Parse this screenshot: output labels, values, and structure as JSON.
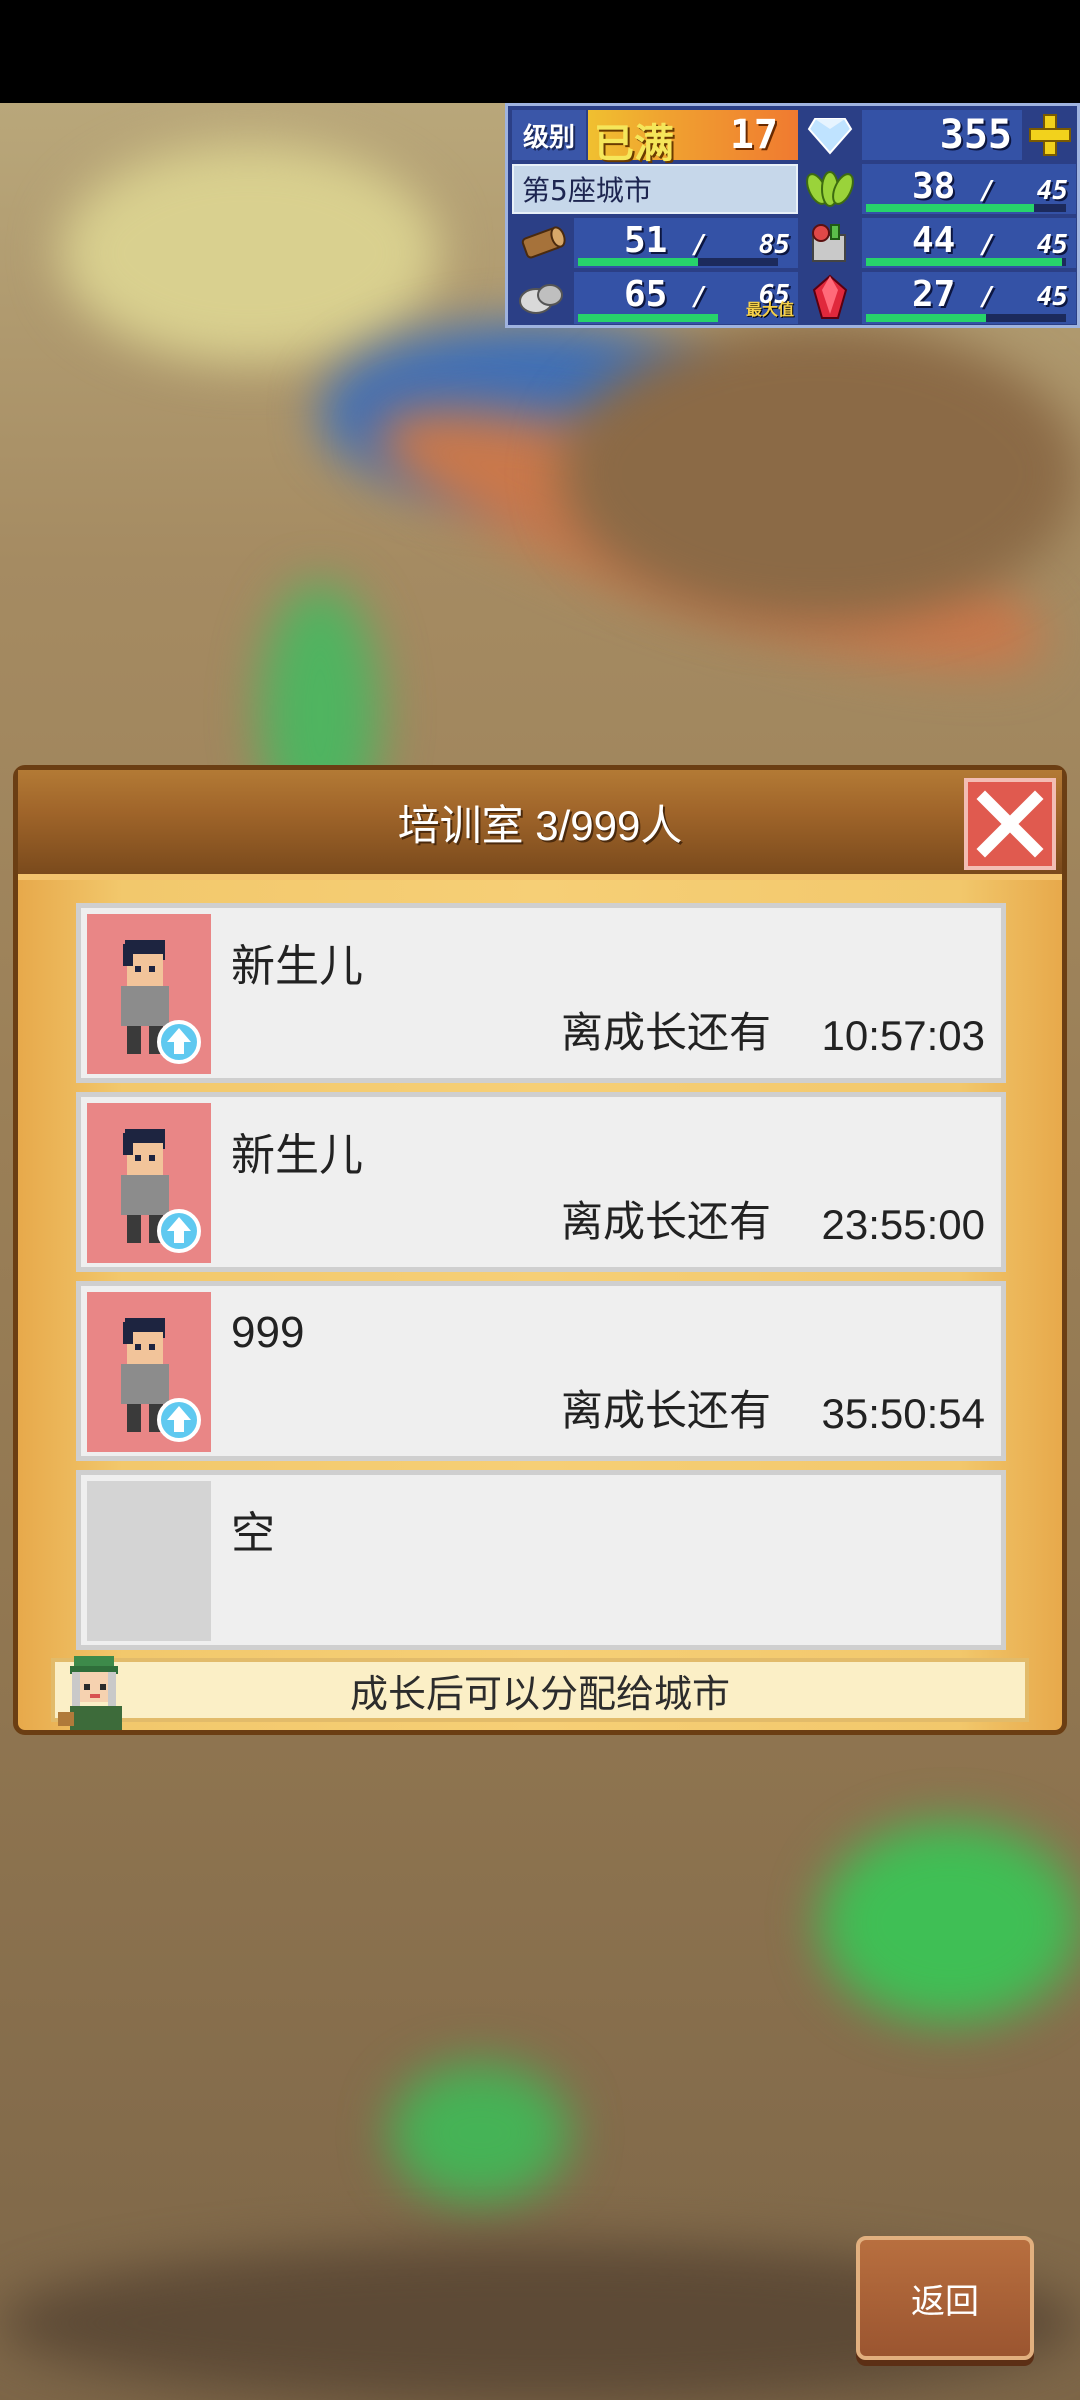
{
  "hud": {
    "level_label": "级别",
    "level_badge": "已满",
    "level_value": "17",
    "diamonds": "355",
    "city_name": "第5座城市",
    "resources": [
      {
        "icon": "wood-log-icon",
        "current": "51",
        "max": "85",
        "fill_fraction": 0.6
      },
      {
        "icon": "stone-ore-icon",
        "current": "65",
        "max": "65",
        "max_note": "最大值",
        "fill_fraction": 1.0
      },
      {
        "icon": "crop-grain-icon",
        "current": "38",
        "max": "45",
        "fill_fraction": 0.84
      },
      {
        "icon": "food-supplies-icon",
        "current": "44",
        "max": "45",
        "fill_fraction": 0.98
      },
      {
        "icon": "red-crystal-icon",
        "current": "27",
        "max": "45",
        "fill_fraction": 0.6
      }
    ],
    "plus_icon": "plus-icon",
    "diamond_icon": "diamond-icon"
  },
  "dialog": {
    "title": "培训室 3/999人",
    "items": [
      {
        "name": "新生儿",
        "label": "离成长还有",
        "time": "10:57:03",
        "avatar": "child-avatar"
      },
      {
        "name": "新生儿",
        "label": "离成长还有",
        "time": "23:55:00",
        "avatar": "child-avatar"
      },
      {
        "name": "999",
        "label": "离成长还有",
        "time": "35:50:54",
        "avatar": "child-avatar"
      },
      {
        "name": "空",
        "label": "",
        "time": "",
        "avatar": "empty"
      }
    ],
    "hint": "成长后可以分配给城市"
  },
  "back_button": "返回",
  "colors": {
    "hud_bg": "#2b3f86",
    "dialog_bg": "#f6cf76",
    "header_bg": "#a0652a",
    "close_bg": "#e05a4f",
    "avatar_bg": "#e98686",
    "progress": "#27d36b"
  }
}
